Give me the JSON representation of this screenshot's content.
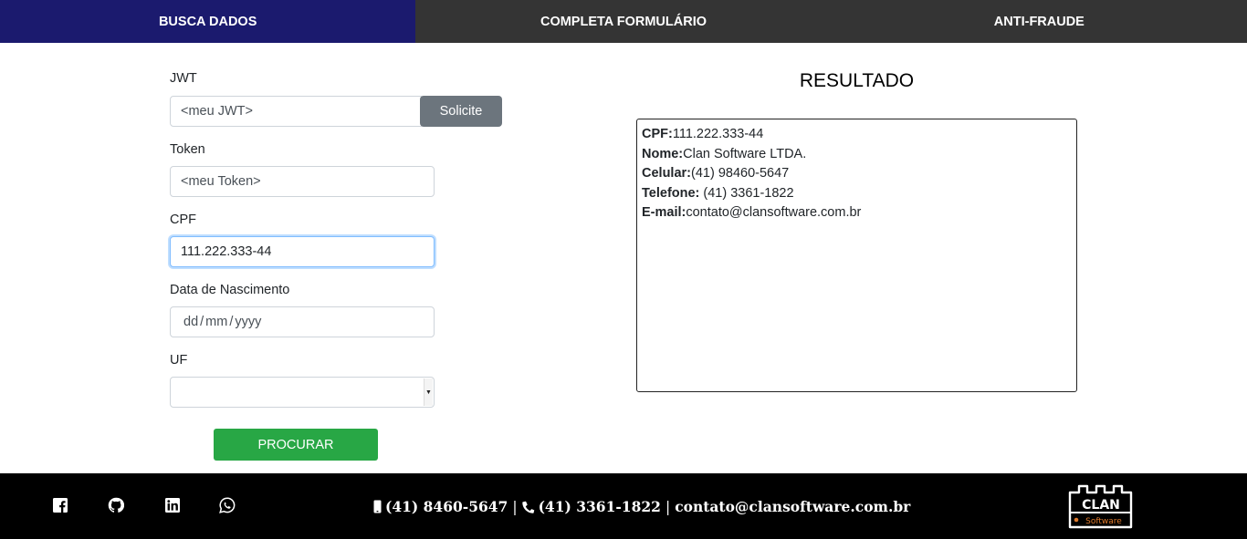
{
  "nav": {
    "tabs": [
      {
        "label": "BUSCA DADOS",
        "active": true
      },
      {
        "label": "COMPLETA FORMULÁRIO",
        "active": false
      },
      {
        "label": "ANTI-FRAUDE",
        "active": false
      }
    ]
  },
  "form": {
    "jwt": {
      "label": "JWT",
      "placeholder": "<meu JWT>",
      "button": "Solicite"
    },
    "token": {
      "label": "Token",
      "placeholder": "<meu Token>"
    },
    "cpf": {
      "label": "CPF",
      "value": "111.222.333-44"
    },
    "birth": {
      "label": "Data de Nascimento",
      "dd": "dd",
      "mm": "mm",
      "yyyy": "yyyy",
      "sep": "/"
    },
    "uf": {
      "label": "UF",
      "value": ""
    },
    "submit": "PROCURAR"
  },
  "result": {
    "title": "RESULTADO",
    "rows": [
      {
        "key": "CPF:",
        "value": "111.222.333-44"
      },
      {
        "key": "Nome:",
        "value": "Clan Software LTDA."
      },
      {
        "key": "Celular:",
        "value": "(41) 98460-5647"
      },
      {
        "key": "Telefone:",
        "value": " (41) 3361-1822"
      },
      {
        "key": "E-mail:",
        "value": "contato@clansoftware.com.br"
      }
    ]
  },
  "footer": {
    "social": [
      "facebook-icon",
      "github-icon",
      "linkedin-icon",
      "whatsapp-icon"
    ],
    "mobile": "(41) 8460-5647",
    "separator": "|",
    "phone": "(41) 3361-1822",
    "email": "contato@clansoftware.com.br",
    "logo_top": "CLAN",
    "logo_bottom": "Software",
    "logo_accent": "#e07a2c"
  },
  "colors": {
    "nav_active": "#1b1a6e",
    "nav_bg": "#343434",
    "solicite_btn": "#6c757d",
    "procurar_btn": "#28a745",
    "footer_bg": "#000000"
  }
}
